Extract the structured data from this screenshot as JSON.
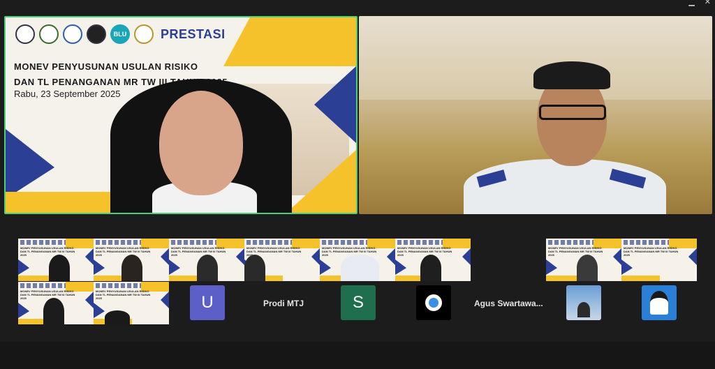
{
  "main_slide": {
    "brand": "PRESTASI",
    "logo_blu": "BLU",
    "title_line1": "MONEV PENYUSUNAN USULAN RISIKO",
    "title_line2": "DAN TL PENANGANAN MR TW III TAHUN 2025",
    "date": "Rabu, 23 September 2025"
  },
  "participants": [
    {
      "initial": "U",
      "color": "#5b5fc7"
    },
    {
      "name": "Prodi MTJ"
    },
    {
      "initial": "S",
      "color": "#1f6f4e"
    },
    {
      "name": "Agus  Swartawa..."
    }
  ],
  "thumbnails": {
    "title": "MONEV PENYUSUNAN USULAN RISIKO DAN TL PENANGANAN MR TW III TAHUN 2025"
  },
  "colors": {
    "active_speaker_border": "#4ed07a",
    "slide_yellow": "#f6c22b",
    "slide_blue": "#2b3f95"
  }
}
